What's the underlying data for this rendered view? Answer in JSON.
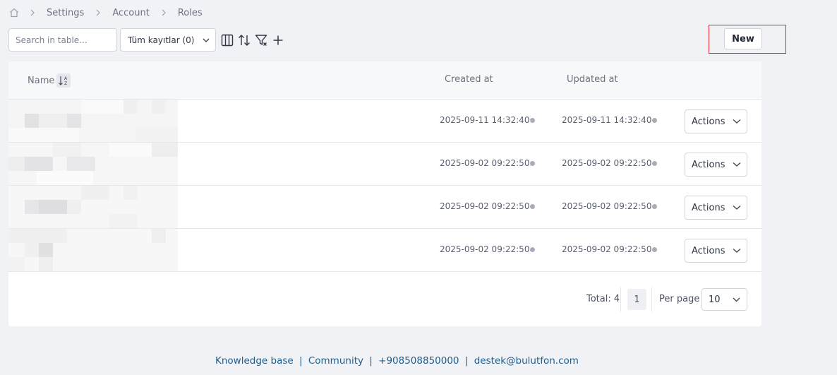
{
  "breadcrumb": {
    "items": [
      "Settings",
      "Account",
      "Roles"
    ]
  },
  "toolbar": {
    "search_placeholder": "Search in table...",
    "filter_select": "Tüm kayıtlar (0)",
    "icons": [
      "columns-icon",
      "sort-icon",
      "filter-icon",
      "plus-icon"
    ]
  },
  "new_button": {
    "label": "New",
    "highlight_color": "#e0242d"
  },
  "table": {
    "columns": {
      "name": "Name",
      "created": "Created at",
      "updated": "Updated at"
    },
    "rows": [
      {
        "created": "2025-09-11 14:32:40",
        "updated": "2025-09-11 14:32:40",
        "action": "Actions"
      },
      {
        "created": "2025-09-02 09:22:50",
        "updated": "2025-09-02 09:22:50",
        "action": "Actions"
      },
      {
        "created": "2025-09-02 09:22:50",
        "updated": "2025-09-02 09:22:50",
        "action": "Actions"
      },
      {
        "created": "2025-09-02 09:22:50",
        "updated": "2025-09-02 09:22:50",
        "action": "Actions"
      }
    ]
  },
  "pagination": {
    "total_label": "Total: 4",
    "page": "1",
    "per_page_label": "Per page",
    "per_page_value": "10"
  },
  "footer": {
    "knowledge_base": "Knowledge base",
    "community": "Community",
    "phone": "+908508850000",
    "email": "destek@bulutfon.com",
    "separator": "|"
  }
}
